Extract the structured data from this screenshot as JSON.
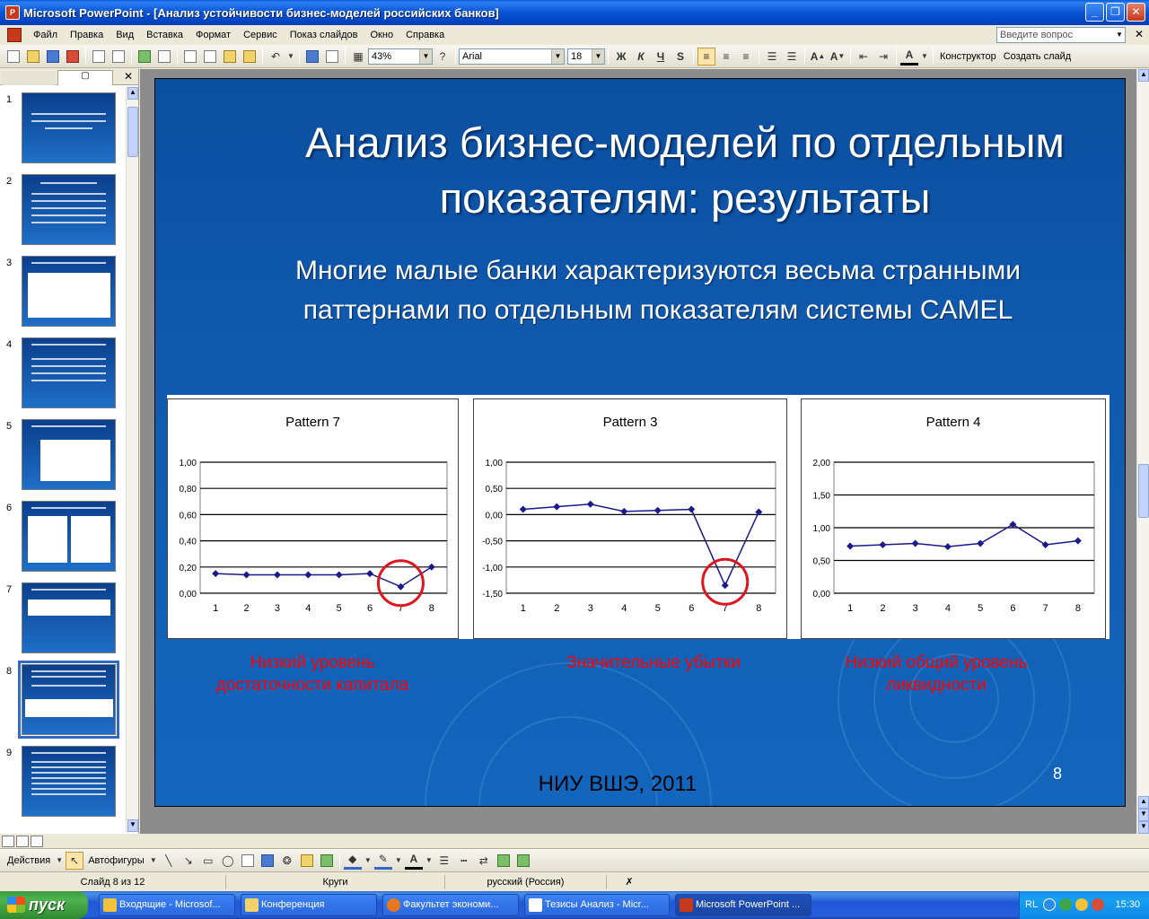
{
  "window": {
    "title": "Microsoft PowerPoint - [Анализ устойчивости бизнес-моделей российских банков]",
    "app_icon": "P",
    "buttons": {
      "minimize": "_",
      "restore": "❐",
      "close": "✕"
    }
  },
  "menu": {
    "items": [
      "Файл",
      "Правка",
      "Вид",
      "Вставка",
      "Формат",
      "Сервис",
      "Показ слайдов",
      "Окно",
      "Справка"
    ],
    "help_placeholder": "Введите вопрос"
  },
  "toolbar": {
    "zoom": "43%",
    "font": "Arial",
    "font_size": "18",
    "bold": "Ж",
    "italic": "К",
    "underline": "Ч",
    "shadow": "S",
    "designer": "Конструктор",
    "new_slide": "Создать слайд"
  },
  "thumbnails": [
    {
      "num": "1"
    },
    {
      "num": "2"
    },
    {
      "num": "3"
    },
    {
      "num": "4"
    },
    {
      "num": "5"
    },
    {
      "num": "6"
    },
    {
      "num": "7"
    },
    {
      "num": "8"
    },
    {
      "num": "9"
    }
  ],
  "slide": {
    "title": "Анализ бизнес-моделей по отдельным показателям: результаты",
    "subtitle": "Многие малые банки характеризуются весьма странными паттернами по отдельным показателям системы CAMEL",
    "captions": [
      "Низкий уровень достаточности капитала",
      "Значительные убытки",
      "Низкий общий уровень ликвидности"
    ],
    "footer": "НИУ ВШЭ, 2011",
    "number": "8"
  },
  "chart_data": [
    {
      "type": "line",
      "title": "Pattern 7",
      "x": [
        "1",
        "2",
        "3",
        "4",
        "5",
        "6",
        "7",
        "8"
      ],
      "x_tick_labels": [
        "1",
        "2",
        "3",
        "4",
        "5",
        "6",
        "7",
        "8"
      ],
      "series": [
        {
          "values": [
            0.15,
            0.14,
            0.14,
            0.14,
            0.14,
            0.15,
            0.05,
            0.2
          ]
        }
      ],
      "ylim": [
        0,
        1
      ],
      "yticks": [
        0,
        0.2,
        0.4,
        0.6,
        0.8,
        1.0
      ],
      "ytick_labels": [
        "0,00",
        "0,20",
        "0,40",
        "0,60",
        "0,80",
        "1,00"
      ],
      "highlight_index": 6,
      "grid": true,
      "line_color": "#1a1a8c",
      "circle_color": "#e0141e"
    },
    {
      "type": "line",
      "title": "Pattern 3",
      "x": [
        "1",
        "2",
        "3",
        "4",
        "5",
        "6",
        "7",
        "8"
      ],
      "x_tick_labels": [
        "1",
        "2",
        "3",
        "4",
        "5",
        "6",
        "7",
        "8"
      ],
      "series": [
        {
          "values": [
            0.1,
            0.15,
            0.2,
            0.06,
            0.08,
            0.1,
            -1.35,
            0.05
          ]
        }
      ],
      "ylim": [
        -1.5,
        1
      ],
      "yticks": [
        -1.5,
        -1.0,
        -0.5,
        0,
        0.5,
        1.0
      ],
      "ytick_labels": [
        "-1,50",
        "-1,00",
        "-0,50",
        "0,00",
        "0,50",
        "1,00"
      ],
      "highlight_index": 6,
      "grid": true,
      "line_color": "#1a1a8c",
      "circle_color": "#e0141e"
    },
    {
      "type": "line",
      "title": "Pattern 4",
      "x": [
        "1",
        "2",
        "3",
        "4",
        "5",
        "6",
        "7",
        "8"
      ],
      "x_tick_labels": [
        "1",
        "2",
        "3",
        "4",
        "5",
        "6",
        "7",
        "8"
      ],
      "series": [
        {
          "values": [
            0.72,
            0.74,
            0.76,
            0.71,
            0.76,
            1.05,
            0.74,
            0.8
          ]
        }
      ],
      "ylim": [
        0,
        2
      ],
      "yticks": [
        0,
        0.5,
        1.0,
        1.5,
        2.0
      ],
      "ytick_labels": [
        "0,00",
        "0,50",
        "1,00",
        "1,50",
        "2,00"
      ],
      "highlight_index": null,
      "grid": true,
      "line_color": "#1a1a8c",
      "circle_color": "#e0141e"
    }
  ],
  "drawing": {
    "actions": "Действия",
    "autoshapes": "Автофигуры"
  },
  "status": {
    "slide": "Слайд 8 из 12",
    "design": "Круги",
    "language": "русский (Россия)"
  },
  "taskbar": {
    "start": "пуск",
    "tasks": [
      "Входящие - Microsof...",
      "Конференция",
      "Факультет экономи...",
      "Тезисы Анализ - Micr...",
      "Microsoft PowerPoint ..."
    ],
    "lang": "RL",
    "clock": "15:30"
  },
  "colors": {
    "accent": "#0a5cd7",
    "slide_bg": "#1366bd",
    "caption_red": "#ff0000"
  }
}
